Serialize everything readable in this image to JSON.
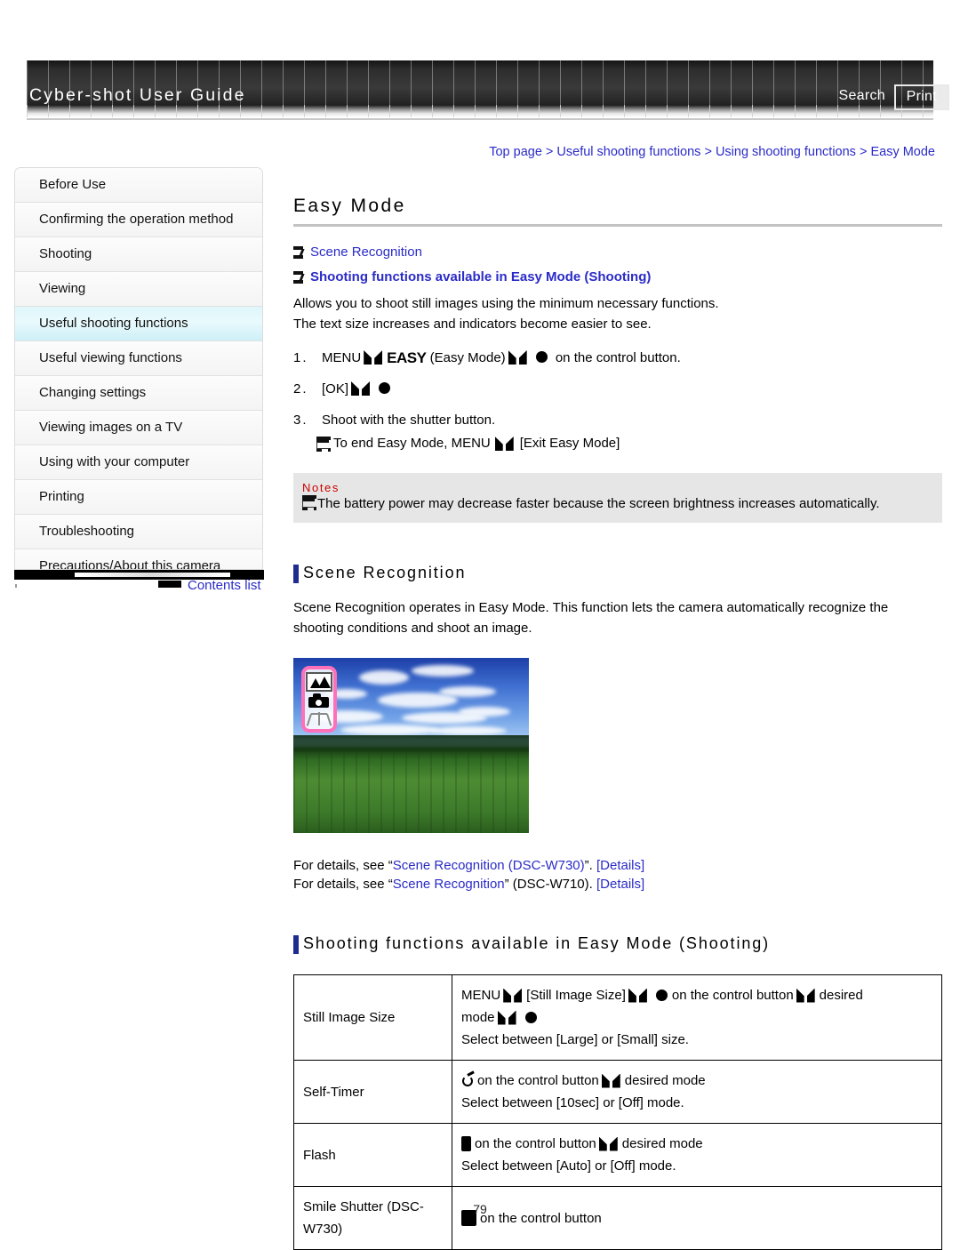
{
  "header": {
    "site_title": "Cyber-shot User Guide",
    "search_label": "Search",
    "print_label": "Print"
  },
  "breadcrumb": {
    "text": "Top page > Useful shooting functions > Using shooting functions > Easy Mode",
    "items": [
      "Top page",
      "Useful shooting functions",
      "Using shooting functions",
      "Easy Mode"
    ]
  },
  "sidebar": {
    "items": [
      {
        "label": "Before Use",
        "active": false
      },
      {
        "label": "Confirming the operation method",
        "active": false
      },
      {
        "label": "Shooting",
        "active": false
      },
      {
        "label": "Viewing",
        "active": false
      },
      {
        "label": "Useful shooting functions",
        "active": true
      },
      {
        "label": "Useful viewing functions",
        "active": false
      },
      {
        "label": "Changing settings",
        "active": false
      },
      {
        "label": "Viewing images on a TV",
        "active": false
      },
      {
        "label": "Using with your computer",
        "active": false
      },
      {
        "label": "Printing",
        "active": false
      },
      {
        "label": "Troubleshooting",
        "active": false
      },
      {
        "label": "Precautions/About this camera",
        "active": false
      }
    ],
    "contents_list_label": "Contents list"
  },
  "main": {
    "page_title": "Easy Mode",
    "jump_links": [
      {
        "label": "Scene Recognition",
        "bold": false
      },
      {
        "label": "Shooting functions available in Easy Mode (Shooting)",
        "bold": true
      }
    ],
    "intro_line1": "Allows you to shoot still images using the minimum necessary functions.",
    "intro_line2": "The text size increases and indicators become easier to see.",
    "steps": [
      {
        "num": "1.",
        "pre": "MENU",
        "logo": "EASY",
        "mid": "(Easy Mode)",
        "post": "on the control button."
      },
      {
        "num": "2.",
        "pre": "[OK]"
      },
      {
        "num": "3.",
        "pre": "Shoot with the shutter button.",
        "sub_pre": "To end Easy Mode, MENU",
        "sub_post": "[Exit Easy Mode]"
      }
    ],
    "notes": {
      "label": "Notes",
      "text": "The battery power may decrease faster because the screen brightness increases automatically."
    },
    "scene_section": {
      "heading": "Scene Recognition",
      "body_line1": "Scene Recognition operates in Easy Mode. This function lets the camera automatically recognize the",
      "body_line2": "shooting conditions and shoot an image.",
      "detail1_pre": "For details, see “",
      "detail1_link": "Scene Recognition (DSC-W730)",
      "detail1_mid": "”. ",
      "detail1_tail": "[Details]",
      "detail2_pre": "For details, see “",
      "detail2_link": "Scene Recognition",
      "detail2_mid": "” (DSC-W710). ",
      "detail2_tail": "[Details]"
    },
    "functions_section": {
      "heading": "Shooting functions available in Easy Mode (Shooting)",
      "rows": [
        {
          "label": "Still Image Size",
          "line1_a": "MENU",
          "line1_b": "[Still Image Size]",
          "line1_c": "on the control button",
          "line1_d": "desired",
          "line2_a": "mode",
          "line3": "Select between [Large] or [Small] size.",
          "icon": "none"
        },
        {
          "label": "Self-Timer",
          "line1_c": "on the control button",
          "line1_d": "desired mode",
          "line3": "Select between [10sec] or [Off] mode.",
          "icon": "self-timer-icon"
        },
        {
          "label": "Flash",
          "line1_c": "on the control button",
          "line1_d": "desired mode",
          "line3": "Select between [Auto] or [Off] mode.",
          "icon": "flash-icon"
        },
        {
          "label": "Smile Shutter (DSC-W730)",
          "line1_c": "on the control button",
          "icon": "smile-shutter-icon"
        }
      ]
    }
  },
  "footer": {
    "page_number": "79"
  },
  "colors": {
    "link": "#2b2bc8",
    "notes_label": "#cc0000",
    "section_bar": "#1f2b8f",
    "sidebar_active": "#dff6fb",
    "overlay_border": "#ff70bb"
  }
}
